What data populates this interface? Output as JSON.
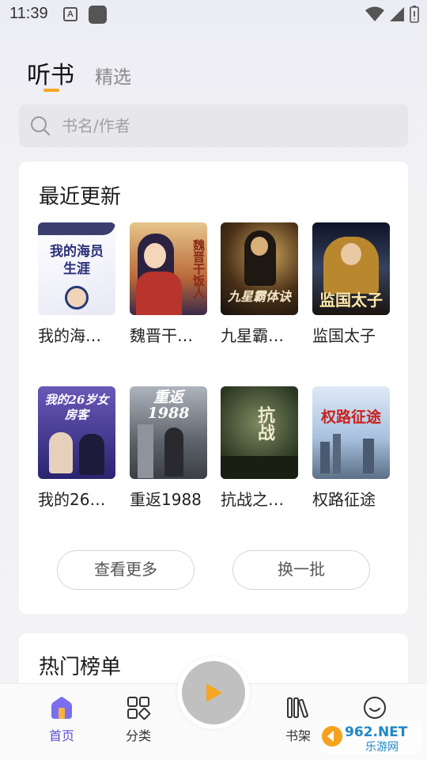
{
  "status_bar": {
    "time": "11:39",
    "a_icon": "A"
  },
  "tabs": {
    "active": "听书",
    "inactive": "精选"
  },
  "search": {
    "placeholder": "书名/作者"
  },
  "recent": {
    "title": "最近更新",
    "books": [
      {
        "title": "我的海…",
        "cover_text": "我的海员生涯",
        "cover_color": "#f3f3fb"
      },
      {
        "title": "魏晋干…",
        "cover_text": "魏晋干饭人",
        "cover_color": "#d9a35a"
      },
      {
        "title": "九星霸…",
        "cover_text": "九星霸体诀",
        "cover_color": "#3a2a1c"
      },
      {
        "title": "监国太子",
        "cover_text": "监国太子",
        "cover_color": "#2b3550"
      },
      {
        "title": "我的26…",
        "cover_text": "我的26岁女房客",
        "cover_color": "#4a3c86"
      },
      {
        "title": "重返1988",
        "cover_text": "重返1988",
        "cover_color": "#6b6f78"
      },
      {
        "title": "抗战之…",
        "cover_text": "抗战",
        "cover_color": "#3d4a2f"
      },
      {
        "title": "权路征途",
        "cover_text": "权路征途",
        "cover_color": "#c8d8ec"
      }
    ],
    "more_button": "查看更多",
    "refresh_button": "换一批"
  },
  "hot": {
    "title": "热门榜单"
  },
  "nav": {
    "home": "首页",
    "category": "分类",
    "shelf": "书架",
    "accent": "#5b4fd8"
  },
  "watermark": {
    "line1": "962.NET",
    "line2": "乐游网"
  }
}
